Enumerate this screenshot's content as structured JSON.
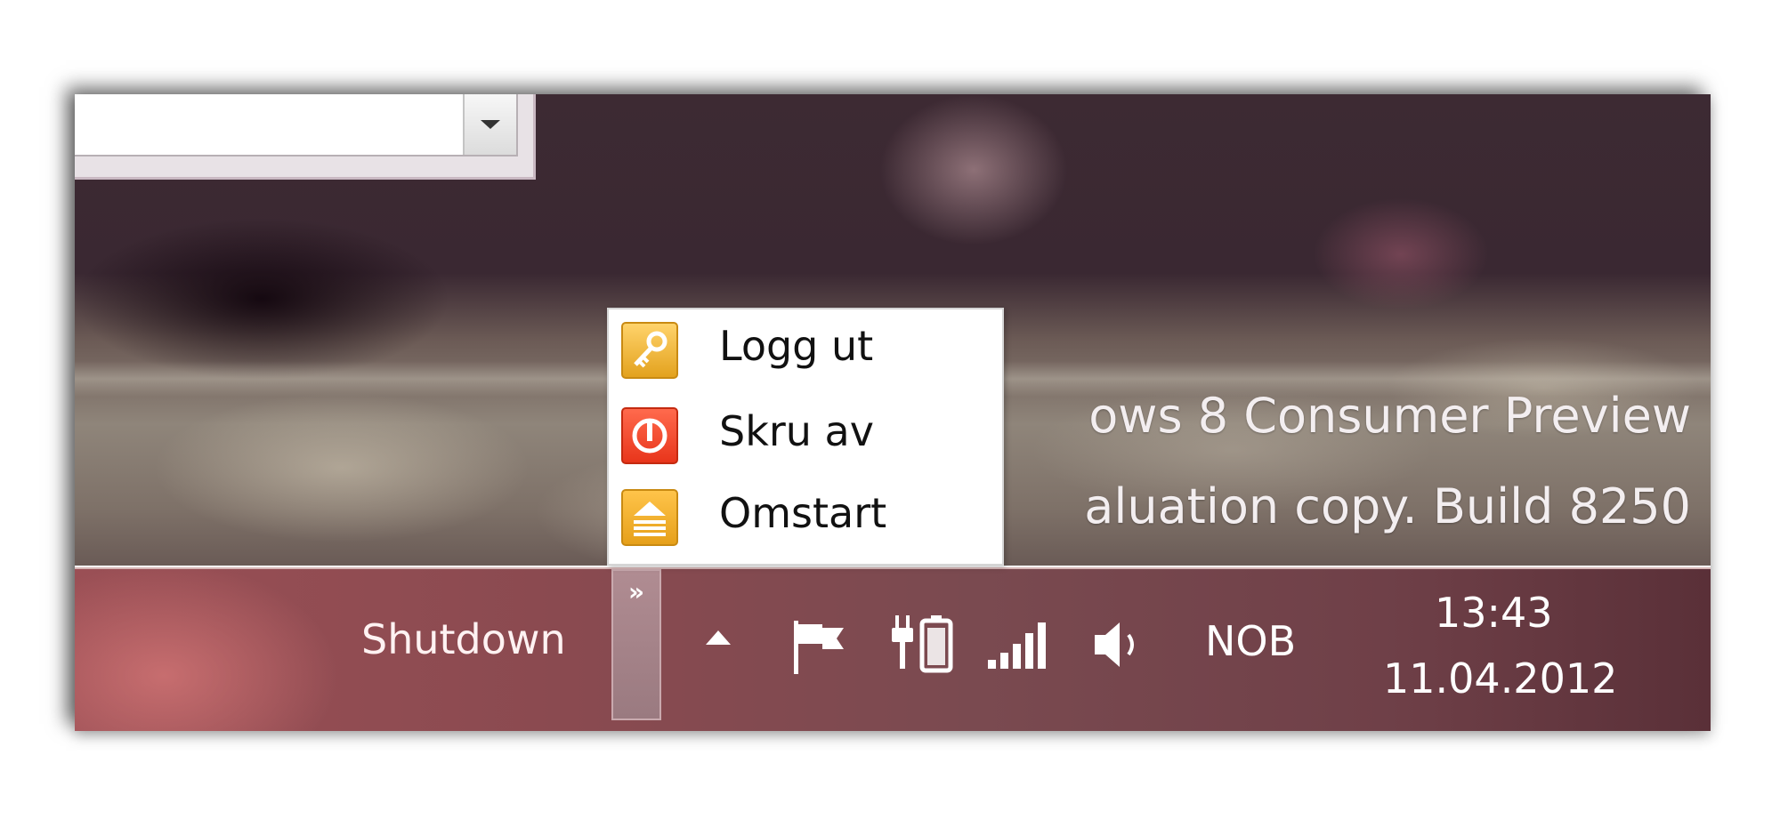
{
  "desktop": {
    "watermark_line1": "ows 8 Consumer Preview",
    "watermark_line2": "aluation copy. Build 8250"
  },
  "shutdown_menu": {
    "items": [
      {
        "label": "Logg ut",
        "icon": "key-icon",
        "color": "#f0b030"
      },
      {
        "label": "Skru av",
        "icon": "power-icon",
        "color": "#e8351b"
      },
      {
        "label": "Omstart",
        "icon": "eject-icon",
        "color": "#f0b030"
      }
    ]
  },
  "taskbar": {
    "toolbar_label": "Shutdown",
    "overflow_glyph": "»",
    "tray_icons": [
      "show-hidden-icons-icon",
      "action-center-flag-icon",
      "battery-plug-icon",
      "network-signal-icon",
      "volume-icon"
    ],
    "language": "NOB",
    "clock": {
      "time": "13:43",
      "date": "11.04.2012"
    }
  },
  "colors": {
    "taskbar": "#8a4a50",
    "menu_bg": "#ffffff"
  }
}
